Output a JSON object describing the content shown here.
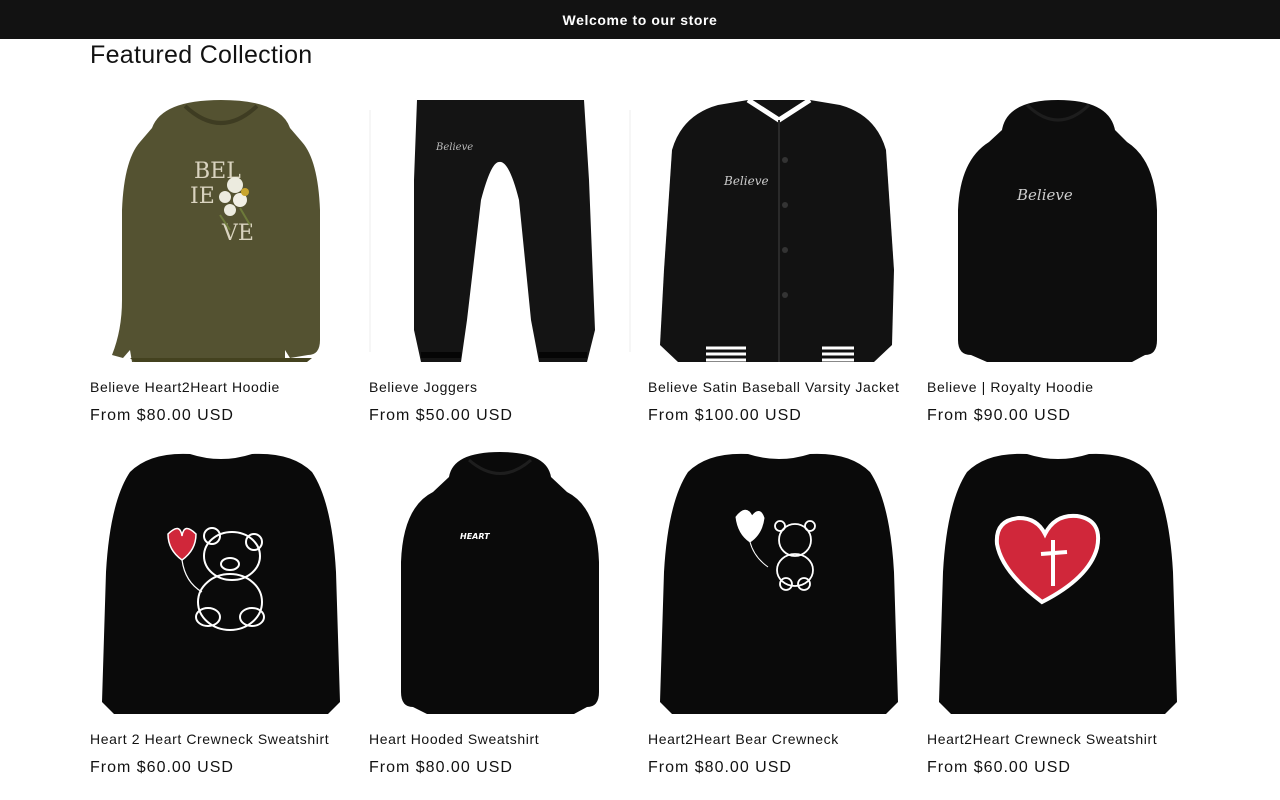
{
  "announcement": {
    "text": "Welcome to our store"
  },
  "section": {
    "title": "Featured Collection"
  },
  "products": [
    {
      "title": "Believe Heart2Heart Hoodie",
      "price": "From $80.00 USD",
      "image_icon": "olive-hoodie-flowers-image",
      "color": "#545231"
    },
    {
      "title": "Believe Joggers",
      "price": "From $50.00 USD",
      "image_icon": "black-joggers-image",
      "color": "#141414"
    },
    {
      "title": "Believe Satin Baseball Varsity Jacket",
      "price": "From $100.00 USD",
      "image_icon": "black-varsity-jacket-image",
      "color": "#101010"
    },
    {
      "title": "Believe | Royalty Hoodie",
      "price": "From $90.00 USD",
      "image_icon": "black-hoodie-script-image",
      "color": "#0d0d0d"
    },
    {
      "title": "Heart 2 Heart Crewneck Sweatshirt",
      "price": "From $60.00 USD",
      "image_icon": "crewneck-bear-balloon-image",
      "color": "#0a0a0a"
    },
    {
      "title": "Heart Hooded Sweatshirt",
      "price": "From $80.00 USD",
      "image_icon": "black-hoodie-small-logo-image",
      "color": "#0a0a0a"
    },
    {
      "title": "Heart2Heart Bear Crewneck",
      "price": "From $80.00 USD",
      "image_icon": "crewneck-small-bear-image",
      "color": "#0a0a0a"
    },
    {
      "title": "Heart2Heart Crewneck Sweatshirt",
      "price": "From $60.00 USD",
      "image_icon": "crewneck-red-heart-cross-image",
      "color": "#0a0a0a"
    }
  ],
  "colors": {
    "announcement_bg": "#121212",
    "text": "#121212",
    "heart_red": "#d0273a"
  }
}
